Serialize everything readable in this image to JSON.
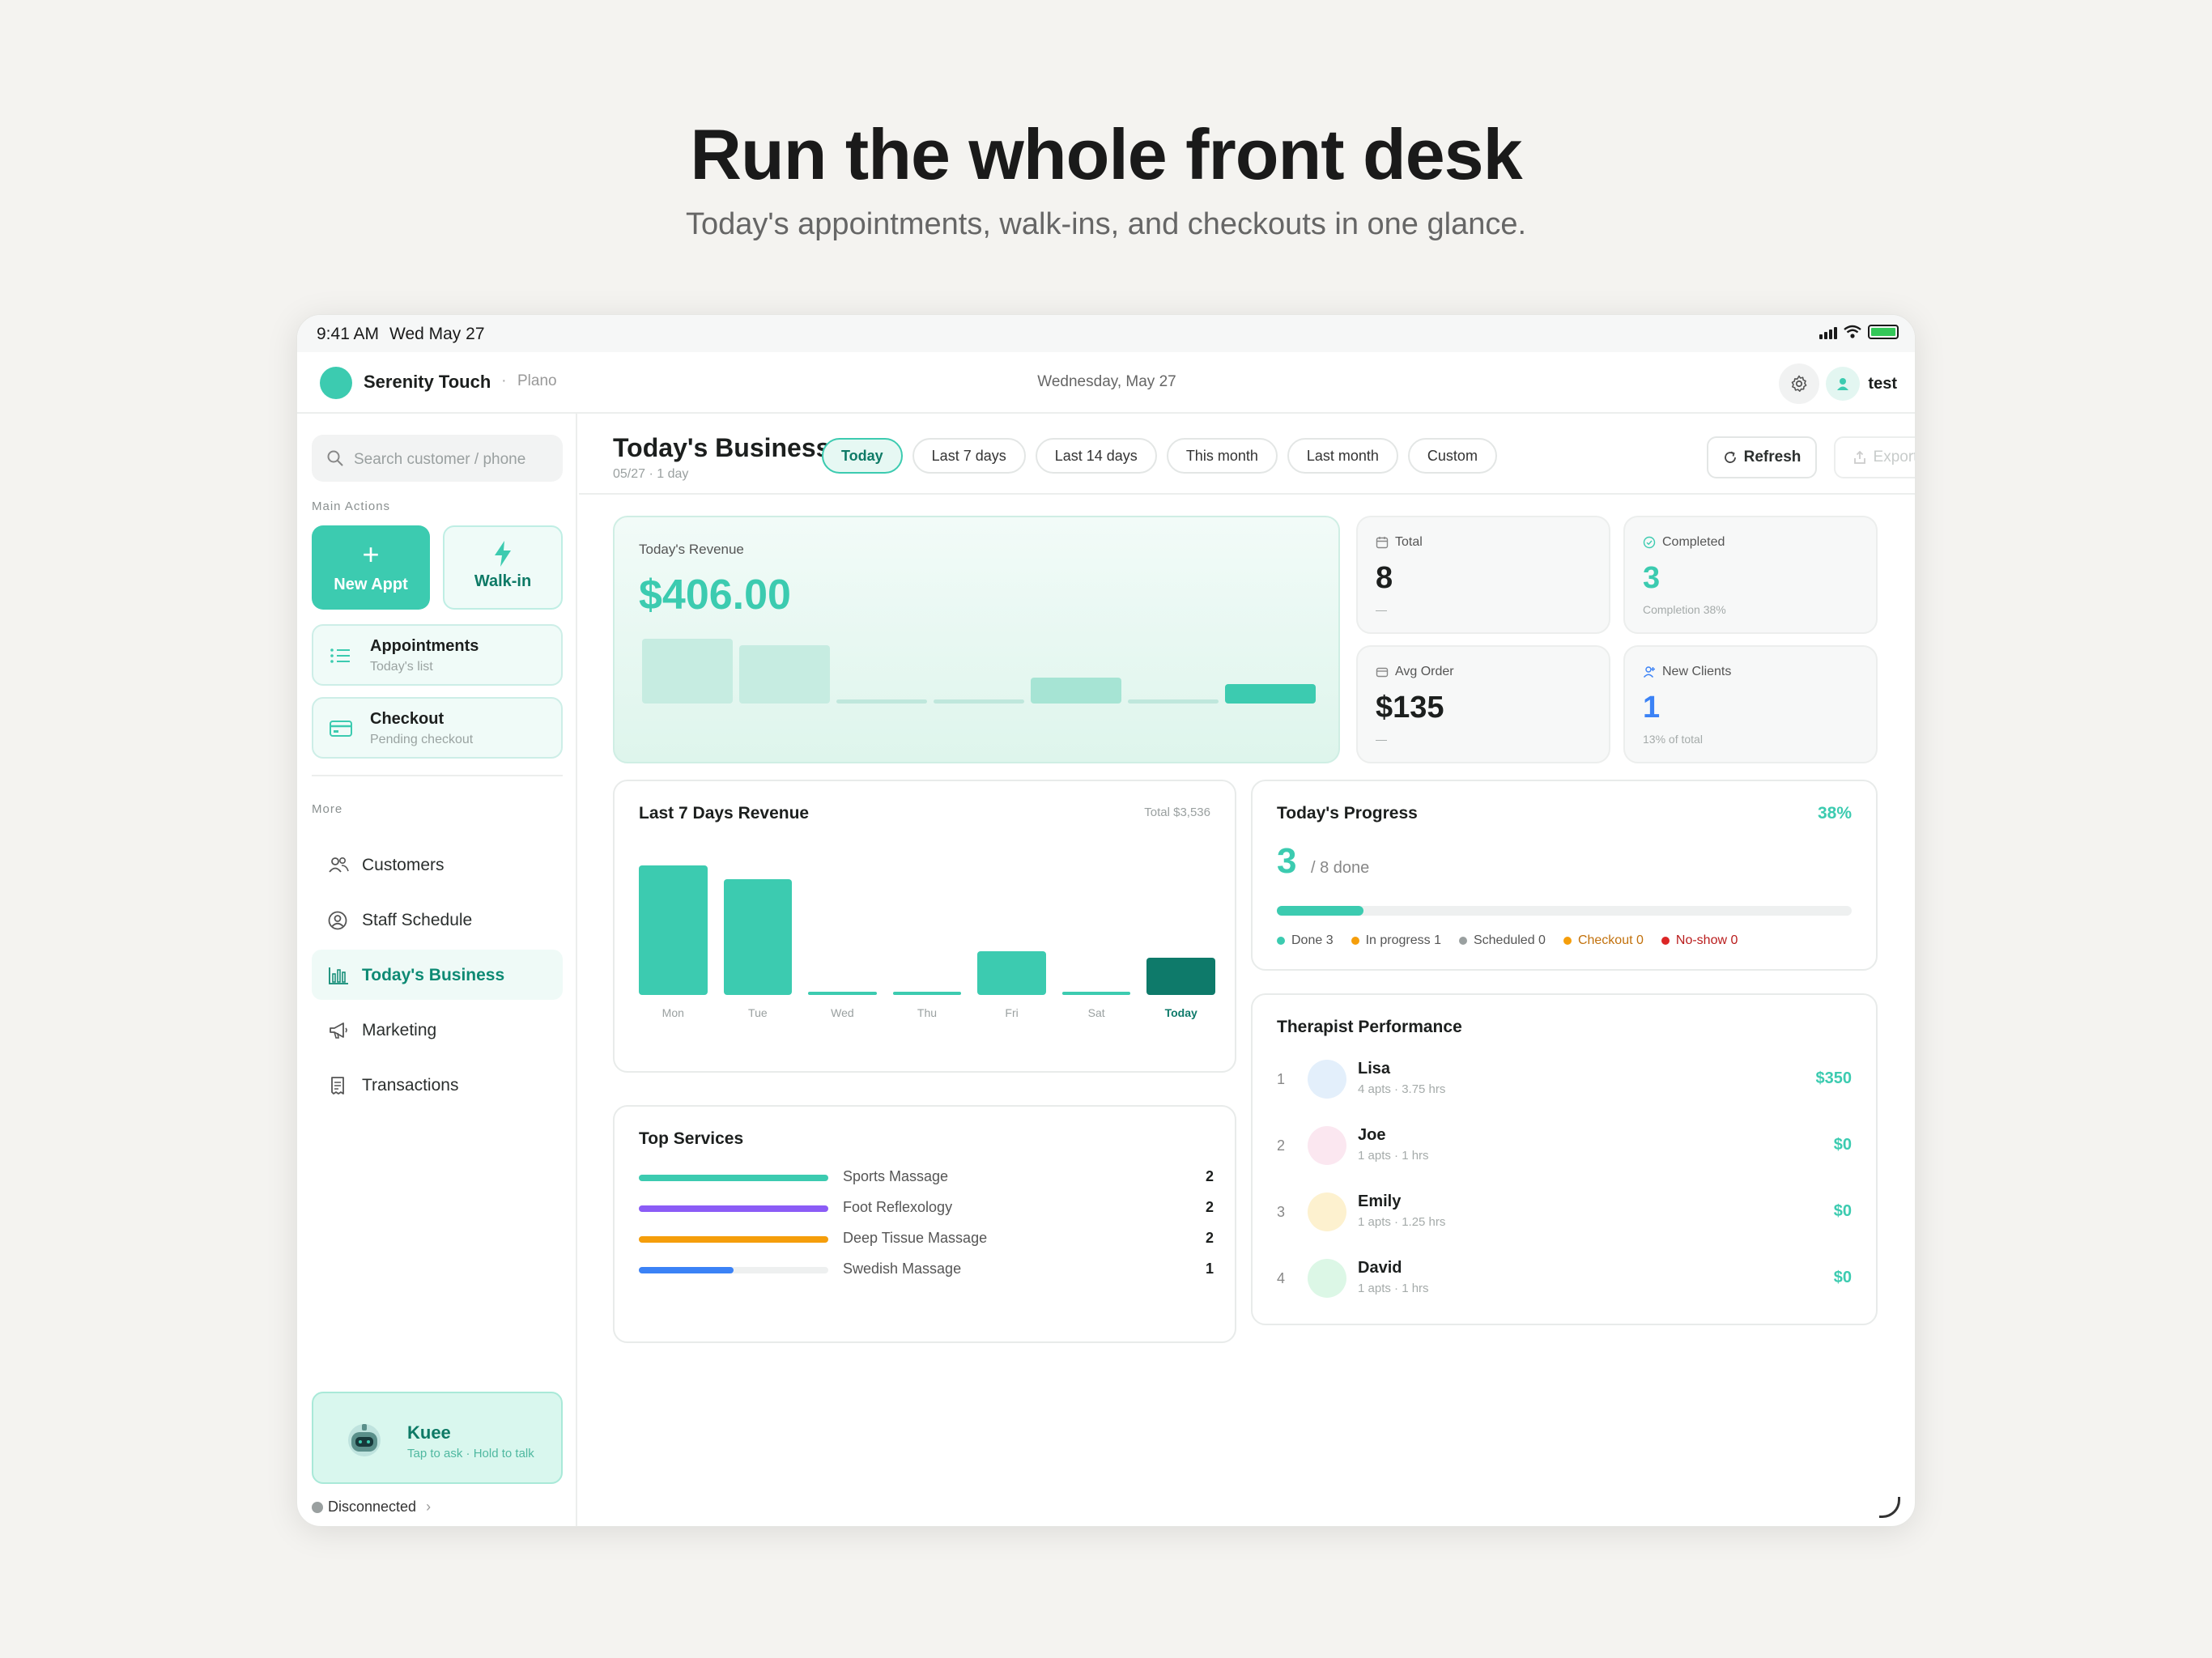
{
  "hero": {
    "title": "Run the whole front desk",
    "subtitle": "Today's appointments, walk-ins, and checkouts in one glance."
  },
  "status_bar": {
    "time": "9:41 AM",
    "date": "Wed May 27",
    "battery_color": "#34c759"
  },
  "app_bar": {
    "brand": "Serenity Touch",
    "separator": "·",
    "location": "Plano",
    "date": "Wednesday, May 27",
    "settings_icon": "gear-icon",
    "user_icon": "person-icon",
    "user": "test"
  },
  "sidebar": {
    "search_placeholder": "Search customer / phone",
    "main_actions_label": "Main Actions",
    "new_appt": {
      "icon": "plus",
      "label": "New Appt"
    },
    "walk_in": {
      "icon": "lightning-icon",
      "label": "Walk-in"
    },
    "cards": [
      {
        "icon": "list-icon",
        "title": "Appointments",
        "subtitle": "Today's list"
      },
      {
        "icon": "card-icon",
        "title": "Checkout",
        "subtitle": "Pending checkout"
      }
    ],
    "more_label": "More",
    "nav": [
      {
        "icon": "users-icon",
        "label": "Customers",
        "active": false
      },
      {
        "icon": "user-circle-icon",
        "label": "Staff Schedule",
        "active": false
      },
      {
        "icon": "bar-chart-icon",
        "label": "Today's Business",
        "active": true
      },
      {
        "icon": "megaphone-icon",
        "label": "Marketing",
        "active": false
      },
      {
        "icon": "receipt-icon",
        "label": "Transactions",
        "active": false
      }
    ],
    "assistant": {
      "name": "Kuee",
      "hint": "Tap to ask · Hold to talk"
    },
    "connection": {
      "status": "Disconnected",
      "chevron": "›"
    }
  },
  "header": {
    "title": "Today's Business",
    "subtitle": "05/27 · 1 day",
    "ranges": [
      "Today",
      "Last 7 days",
      "Last 14 days",
      "This month",
      "Last month",
      "Custom"
    ],
    "active_range": "Today",
    "refresh": "Refresh",
    "export": "Export"
  },
  "revenue": {
    "label": "Today's Revenue",
    "value": "$406.00",
    "mini_levels": [
      1.0,
      0.9,
      0.06,
      0.06,
      0.4,
      0.06,
      0.3
    ],
    "mini_colors": [
      "#c6ece1",
      "#c6ece1",
      "#bfe7dc",
      "#bfe7dc",
      "#a6e4d4",
      "#bfe7dc",
      "#3ccbb0"
    ]
  },
  "stats": [
    {
      "icon": "calendar-icon",
      "label": "Total",
      "value": "8",
      "footer": "—",
      "value_color": "#1c1f1e"
    },
    {
      "icon": "check-circle-icon",
      "label": "Completed",
      "value": "3",
      "footer": "Completion 38%",
      "value_color": "#3ccbb0"
    },
    {
      "icon": "wallet-icon",
      "label": "Avg Order",
      "value": "$135",
      "footer": "—",
      "value_color": "#1c1f1e"
    },
    {
      "icon": "user-plus-icon",
      "label": "New Clients",
      "value": "1",
      "footer": "13% of total",
      "value_color": "#3b82f6"
    }
  ],
  "week": {
    "title": "Last 7 Days Revenue",
    "total": "Total $3,536",
    "chart_data": {
      "type": "bar",
      "categories": [
        "Mon",
        "Tue",
        "Wed",
        "Thu",
        "Fri",
        "Sat",
        "Today"
      ],
      "values": [
        1405,
        1255,
        0,
        0,
        470,
        0,
        406
      ],
      "colors": [
        "#3ccbb0",
        "#3ccbb0",
        "#3ccbb0",
        "#3ccbb0",
        "#3ccbb0",
        "#3ccbb0",
        "#0e7a6a"
      ]
    }
  },
  "services": {
    "title": "Top Services",
    "items": [
      {
        "name": "Sports Massage",
        "count": "2",
        "fraction": 1.0,
        "color": "#3ccbb0"
      },
      {
        "name": "Foot Reflexology",
        "count": "2",
        "fraction": 1.0,
        "color": "#8b5cf6"
      },
      {
        "name": "Deep Tissue Massage",
        "count": "2",
        "fraction": 1.0,
        "color": "#f59e0b"
      },
      {
        "name": "Swedish Massage",
        "count": "1",
        "fraction": 0.5,
        "color": "#3b82f6"
      }
    ]
  },
  "progress": {
    "title": "Today's Progress",
    "percent": "38%",
    "done": "3",
    "of_label": "/ 8 done",
    "fraction": 0.375,
    "legend": [
      {
        "label": "Done 3",
        "color": "#3ccbb0",
        "text_color": "#555555"
      },
      {
        "label": "In progress 1",
        "color": "#f59e0b",
        "text_color": "#555555"
      },
      {
        "label": "Scheduled 0",
        "color": "#9aa0a0",
        "text_color": "#555555"
      },
      {
        "label": "Checkout 0",
        "color": "#f59e0b",
        "text_color": "#c2710c"
      },
      {
        "label": "No-show 0",
        "color": "#dc2626",
        "text_color": "#b91c1c"
      }
    ]
  },
  "therapists": {
    "title": "Therapist Performance",
    "rows": [
      {
        "rank": "1",
        "name": "Lisa",
        "meta": "4 apts · 3.75 hrs",
        "amount": "$350",
        "avatar_color": "#e3effb"
      },
      {
        "rank": "2",
        "name": "Joe",
        "meta": "1 apts · 1 hrs",
        "amount": "$0",
        "avatar_color": "#fbe7f0"
      },
      {
        "rank": "3",
        "name": "Emily",
        "meta": "1 apts · 1.25 hrs",
        "amount": "$0",
        "avatar_color": "#fdf1cf"
      },
      {
        "rank": "4",
        "name": "David",
        "meta": "1 apts · 1 hrs",
        "amount": "$0",
        "avatar_color": "#dcf7e6"
      }
    ]
  }
}
